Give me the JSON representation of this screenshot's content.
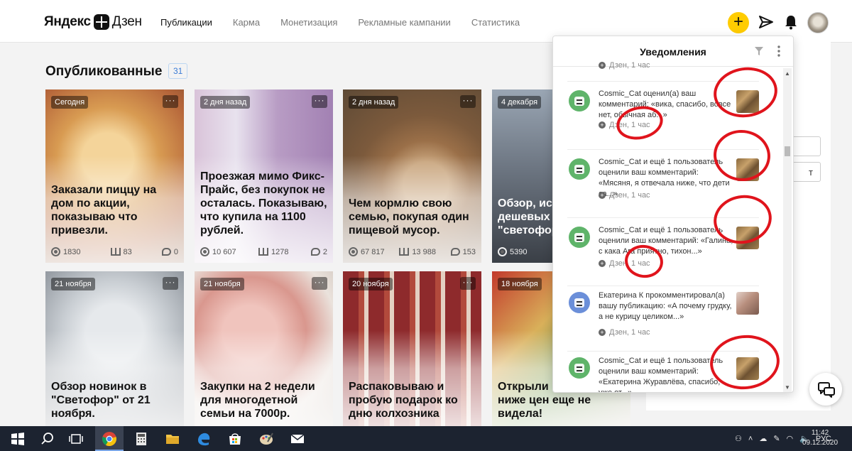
{
  "header": {
    "logo_left": "Яндекс",
    "logo_right": "Дзен",
    "nav": [
      {
        "label": "Публикации",
        "active": true
      },
      {
        "label": "Карма",
        "active": false
      },
      {
        "label": "Монетизация",
        "active": false
      },
      {
        "label": "Рекламные кампании",
        "active": false
      },
      {
        "label": "Статистика",
        "active": false
      }
    ],
    "plus_label": "+",
    "accent_color": "#ffcc00"
  },
  "section": {
    "title": "Опубликованные",
    "count": "31"
  },
  "cards": [
    {
      "date": "Сегодня",
      "title": "Заказали пиццу на дом по акции, показываю что привезли.",
      "views": "1830",
      "reads": "83",
      "comments": "0"
    },
    {
      "date": "2 дня назад",
      "title": "Проезжая мимо Фикс-Прайс, без покупок не осталась. Показываю, что купила на 1100 рублей.",
      "views": "10 607",
      "reads": "1278",
      "comments": "2"
    },
    {
      "date": "2 дня назад",
      "title": "Чем кормлю свою семью, покупая один пищевой мусор.",
      "views": "67 817",
      "reads": "13 988",
      "comments": "153"
    },
    {
      "date": "4 декабря",
      "title": "Обзор, ис разбор са дешевых женской г \"светофор",
      "views": "5390",
      "reads": "",
      "comments": ""
    },
    {
      "date": "21 ноября",
      "title": "Обзор новинок в \"Светофор\" от 21 ноября.",
      "views": "",
      "reads": "",
      "comments": ""
    },
    {
      "date": "21 ноября",
      "title": "Закупки на 2 недели для многодетной семьи на 7000р.",
      "views": "",
      "reads": "",
      "comments": ""
    },
    {
      "date": "20 ноября",
      "title": "Распаковываю и пробую подарок ко дню колхозника",
      "views": "",
      "reads": "",
      "comments": ""
    },
    {
      "date": "18 ноября",
      "title": "Открыли н продуктон ниже цен еще не видела!",
      "views": "",
      "reads": "",
      "comments": ""
    }
  ],
  "side_panel": {
    "button_text": "т"
  },
  "notifications": {
    "title": "Уведомления",
    "top_meta": "Дзен, 1 час",
    "items": [
      {
        "text": "Cosmic_Cat оценил(а) ваш комментарий: «вика, спасибо, вовсе нет, обычная аб...»",
        "meta": "Дзен, 1 час",
        "avatar": "green"
      },
      {
        "text": "Cosmic_Cat и ещё 1 пользователь оценили ваш комментарий: «Мясяня, я отвечала ниже, что дети са...»",
        "meta": "Дзен, 1 час",
        "avatar": "green"
      },
      {
        "text": "Cosmic_Cat и ещё 1 пользователь оценили ваш комментарий: «Галина, с кака Ага приятно, тихон...»",
        "meta": "Дзен, 1 час",
        "avatar": "green"
      },
      {
        "text": "Екатерина К прокомментировал(а) вашу публикацию: «А почему грудку, а не курицу целиком...»",
        "meta": "Дзен, 1 час",
        "avatar": "blue"
      },
      {
        "text": "Cosmic_Cat и ещё 1 пользователь оценили ваш комментарий: «Екатерина Журавлёва, спасибо, уже от...»",
        "meta": "",
        "avatar": "green"
      }
    ],
    "annotation_color": "#e0141c"
  },
  "taskbar": {
    "language": "РУС",
    "time": "11:42",
    "date": "09.12.2020"
  }
}
